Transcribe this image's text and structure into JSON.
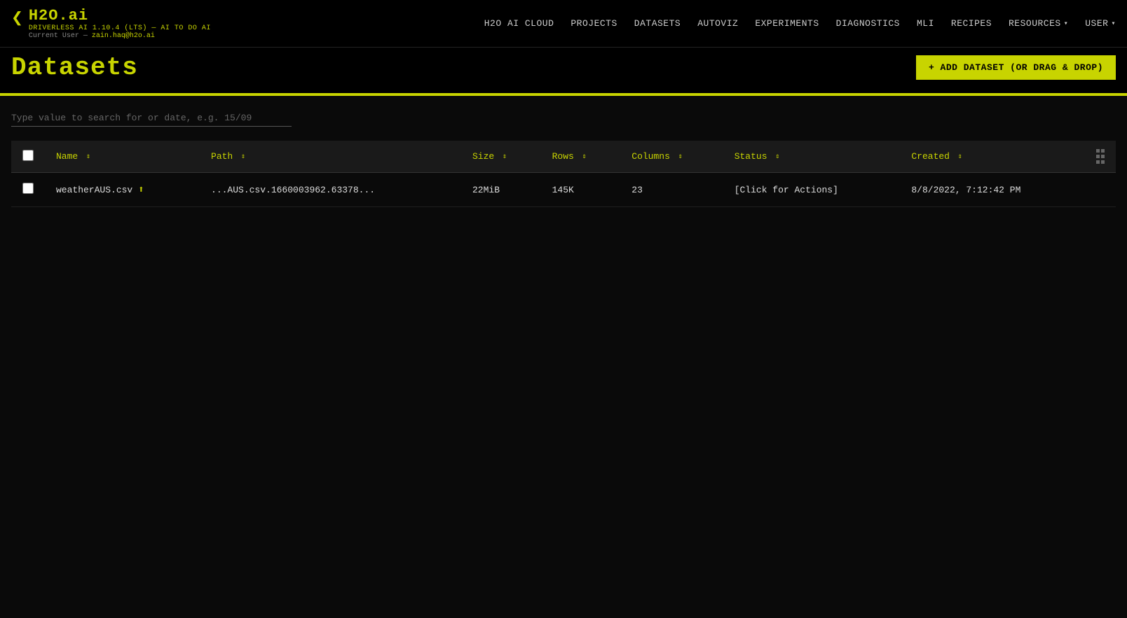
{
  "brand": {
    "title": "H2O.ai",
    "arrow": "❮",
    "subtitle": "DRIVERLESS AI 1.10.4 (LTS) — AI TO DO AI",
    "current_user_label": "Current User —",
    "current_user_email": "zain.haq@h2o.ai"
  },
  "nav": {
    "links": [
      {
        "label": "H2O AI CLOUD",
        "has_dropdown": false
      },
      {
        "label": "PROJECTS",
        "has_dropdown": false
      },
      {
        "label": "DATASETS",
        "has_dropdown": false
      },
      {
        "label": "AUTOVIZ",
        "has_dropdown": false
      },
      {
        "label": "EXPERIMENTS",
        "has_dropdown": false
      },
      {
        "label": "DIAGNOSTICS",
        "has_dropdown": false
      },
      {
        "label": "MLI",
        "has_dropdown": false
      },
      {
        "label": "RECIPES",
        "has_dropdown": false
      },
      {
        "label": "RESOURCES",
        "has_dropdown": true
      },
      {
        "label": "USER",
        "has_dropdown": true
      }
    ]
  },
  "page": {
    "title": "Datasets",
    "add_button_label": "+ ADD DATASET (OR DRAG & DROP)"
  },
  "search": {
    "placeholder": "Type value to search for or date, e.g. 15/09",
    "value": ""
  },
  "table": {
    "columns": [
      {
        "label": "Name",
        "sort": true
      },
      {
        "label": "Path",
        "sort": true
      },
      {
        "label": "Size",
        "sort": true
      },
      {
        "label": "Rows",
        "sort": true
      },
      {
        "label": "Columns",
        "sort": true
      },
      {
        "label": "Status",
        "sort": true
      },
      {
        "label": "Created",
        "sort": true
      }
    ],
    "rows": [
      {
        "name": "weatherAUS.csv",
        "path": "...AUS.csv.1660003962.63378...",
        "size": "22MiB",
        "rows": "145K",
        "columns": "23",
        "status": "[Click for Actions]",
        "created": "8/8/2022, 7:12:42 PM"
      }
    ]
  }
}
